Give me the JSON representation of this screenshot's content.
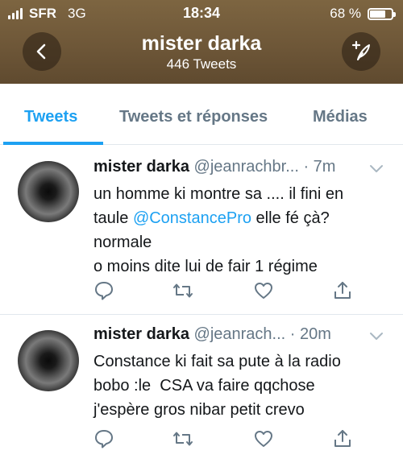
{
  "status_bar": {
    "carrier": "SFR",
    "network": "3G",
    "time": "18:34",
    "battery": "68 %"
  },
  "profile": {
    "name": "mister darka",
    "tweet_count": "446 Tweets"
  },
  "tabs": [
    {
      "label": "Tweets"
    },
    {
      "label": "Tweets et réponses"
    },
    {
      "label": "Médias"
    }
  ],
  "tweets": [
    {
      "name": "mister darka",
      "handle": "@jeanrachbr...",
      "time": "· 7m",
      "lines": [
        "un homme ki montre sa .... il fini en",
        "taule ",
        "@ConstancePro",
        " elle fé çà?",
        "normale",
        "o moins dite lui de fair 1 régime"
      ]
    },
    {
      "name": "mister darka",
      "handle": "@jeanrach...",
      "time": "· 20m",
      "lines": [
        "Constance ki fait sa pute à la radio",
        "bobo :le  CSA va faire qqchose",
        "j'espère gros nibar petit crevo"
      ]
    }
  ],
  "icons": [
    "signal-icon",
    "battery-icon",
    "back-icon",
    "compose-icon",
    "chevron-down-icon",
    "reply-icon",
    "retweet-icon",
    "like-icon",
    "share-icon"
  ],
  "colors": {
    "accent": "#1da1f2",
    "header_bg": "#6e5738",
    "muted": "#657786"
  }
}
